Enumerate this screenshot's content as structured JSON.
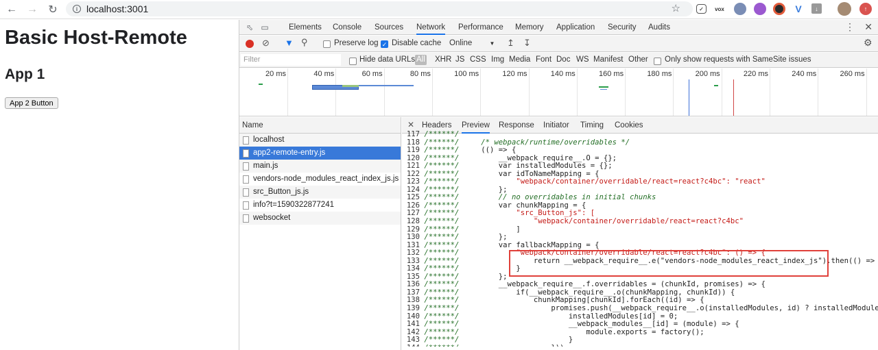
{
  "browser": {
    "url": "localhost:3001"
  },
  "page": {
    "title": "Basic Host-Remote",
    "subtitle": "App 1",
    "button_label": "App 2 Button"
  },
  "devtools": {
    "tabs": [
      "Elements",
      "Console",
      "Sources",
      "Network",
      "Performance",
      "Memory",
      "Application",
      "Security",
      "Audits"
    ],
    "active_tab": "Network",
    "toolbar": {
      "preserve_log": "Preserve log",
      "disable_cache": "Disable cache",
      "throttle": "Online"
    },
    "filter": {
      "placeholder": "Filter",
      "hide_data_urls": "Hide data URLs",
      "types": [
        "All",
        "XHR",
        "JS",
        "CSS",
        "Img",
        "Media",
        "Font",
        "Doc",
        "WS",
        "Manifest",
        "Other"
      ],
      "samesite": "Only show requests with SameSite issues"
    },
    "timeline_ticks": [
      "20 ms",
      "40 ms",
      "60 ms",
      "80 ms",
      "100 ms",
      "120 ms",
      "140 ms",
      "160 ms",
      "180 ms",
      "200 ms",
      "220 ms",
      "240 ms",
      "260 ms"
    ],
    "name_header": "Name",
    "requests": [
      "localhost",
      "app2-remote-entry.js",
      "main.js",
      "vendors-node_modules_react_index_js.js",
      "src_Button_js.js",
      "info?t=1590322877241",
      "websocket"
    ],
    "selected_request": "app2-remote-entry.js",
    "detail_tabs": [
      "Headers",
      "Preview",
      "Response",
      "Initiator",
      "Timing",
      "Cookies"
    ],
    "active_detail_tab": "Preview",
    "code_lines": [
      {
        "n": "117",
        "t": ""
      },
      {
        "n": "118",
        "t": "/* webpack/runtime/overridables */",
        "k": "cm",
        "i": 4
      },
      {
        "n": "119",
        "t": "(() => {",
        "i": 4
      },
      {
        "n": "120",
        "t": "__webpack_require__.O = {};",
        "i": 8
      },
      {
        "n": "121",
        "t": "var installedModules = {};",
        "i": 8
      },
      {
        "n": "122",
        "t": "var idToNameMapping = {",
        "i": 8
      },
      {
        "n": "123",
        "t": "\"webpack/container/overridable/react=react?c4bc\": \"react\"",
        "k": "str",
        "i": 12
      },
      {
        "n": "124",
        "t": "};",
        "i": 8
      },
      {
        "n": "125",
        "t": "// no overridables in initial chunks",
        "k": "cm",
        "i": 8
      },
      {
        "n": "126",
        "t": "var chunkMapping = {",
        "i": 8
      },
      {
        "n": "127",
        "t": "\"src_Button_js\": [",
        "k": "str",
        "i": 12
      },
      {
        "n": "128",
        "t": "\"webpack/container/overridable/react=react?c4bc\"",
        "k": "str",
        "i": 16
      },
      {
        "n": "129",
        "t": "]",
        "i": 12
      },
      {
        "n": "130",
        "t": "};",
        "i": 8
      },
      {
        "n": "131",
        "t": "var fallbackMapping = {",
        "i": 8
      },
      {
        "n": "132",
        "t": "\"webpack/container/overridable/react=react?c4bc\": () => {",
        "k": "str",
        "i": 12
      },
      {
        "n": "133",
        "t": "return __webpack_require__.e(\"vendors-node_modules_react_index_js\").then(() =>",
        "i": 16
      },
      {
        "n": "134",
        "t": "}",
        "i": 12
      },
      {
        "n": "135",
        "t": "};",
        "i": 8
      },
      {
        "n": "136",
        "t": "__webpack_require__.f.overridables = (chunkId, promises) => {",
        "i": 8
      },
      {
        "n": "137",
        "t": "if(__webpack_require__.o(chunkMapping, chunkId)) {",
        "i": 12
      },
      {
        "n": "138",
        "t": "chunkMapping[chunkId].forEach((id) => {",
        "i": 16
      },
      {
        "n": "139",
        "t": "promises.push(__webpack_require__.o(installedModules, id) ? installedModules",
        "i": 20
      },
      {
        "n": "140",
        "t": "installedModules[id] = 0;",
        "i": 24
      },
      {
        "n": "141",
        "t": "__webpack_modules__[id] = (module) => {",
        "i": 24
      },
      {
        "n": "142",
        "t": "module.exports = factory();",
        "i": 28
      },
      {
        "n": "143",
        "t": "}",
        "i": 24
      },
      {
        "n": "144",
        "t": "}))",
        "i": 20
      }
    ],
    "gutter_marker": "/******/"
  }
}
